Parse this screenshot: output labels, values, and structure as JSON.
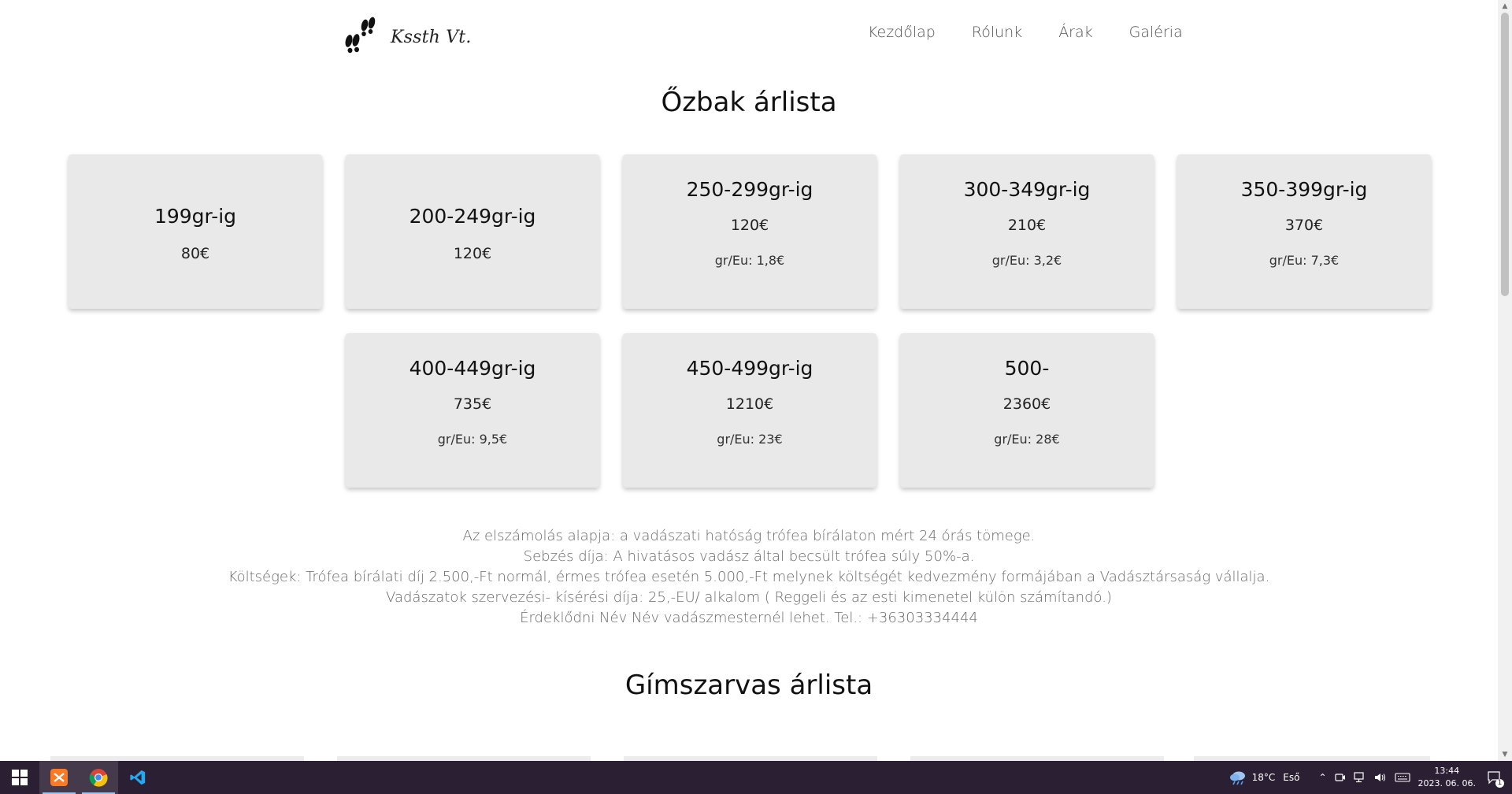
{
  "header": {
    "logo_text": "Kssth Vt.",
    "nav": [
      "Kezdőlap",
      "Rólunk",
      "Árak",
      "Galéria"
    ]
  },
  "ozbak": {
    "title": "Őzbak árlista",
    "cards": [
      {
        "range": "199gr-ig",
        "price": "80€"
      },
      {
        "range": "200-249gr-ig",
        "price": "120€"
      },
      {
        "range": "250-299gr-ig",
        "price": "120€",
        "ratio": "gr/Eu: 1,8€"
      },
      {
        "range": "300-349gr-ig",
        "price": "210€",
        "ratio": "gr/Eu: 3,2€"
      },
      {
        "range": "350-399gr-ig",
        "price": "370€",
        "ratio": "gr/Eu: 7,3€"
      },
      {
        "range": "400-449gr-ig",
        "price": "735€",
        "ratio": "gr/Eu: 9,5€"
      },
      {
        "range": "450-499gr-ig",
        "price": "1210€",
        "ratio": "gr/Eu: 23€"
      },
      {
        "range": "500-",
        "price": "2360€",
        "ratio": "gr/Eu: 28€"
      }
    ],
    "info": [
      "Az elszámolás alapja: a vadászati hatóság trófea bírálaton mért 24 órás tömege.",
      "Sebzés díja: A hivatásos vadász által becsült trófea súly 50%-a.",
      "Költségek: Trófea bírálati díj 2.500,-Ft normál, érmes trófea esetén 5.000,-Ft melynek költségét kedvezmény formájában a Vadásztársaság vállalja.",
      "Vadászatok szervezési- kísérési díja: 25,-EU/ alkalom ( Reggeli és az esti kimenetel külön számítandó.)",
      "Érdeklődni Név Név vadászmesternél lehet. Tel.: +36303334444"
    ]
  },
  "gimszarvas": {
    "title": "Gímszarvas árlista"
  },
  "taskbar": {
    "weather_temp": "18°C",
    "weather_text": "Eső",
    "time": "13:44",
    "date": "2023. 06. 06.",
    "notification_count": "1"
  }
}
